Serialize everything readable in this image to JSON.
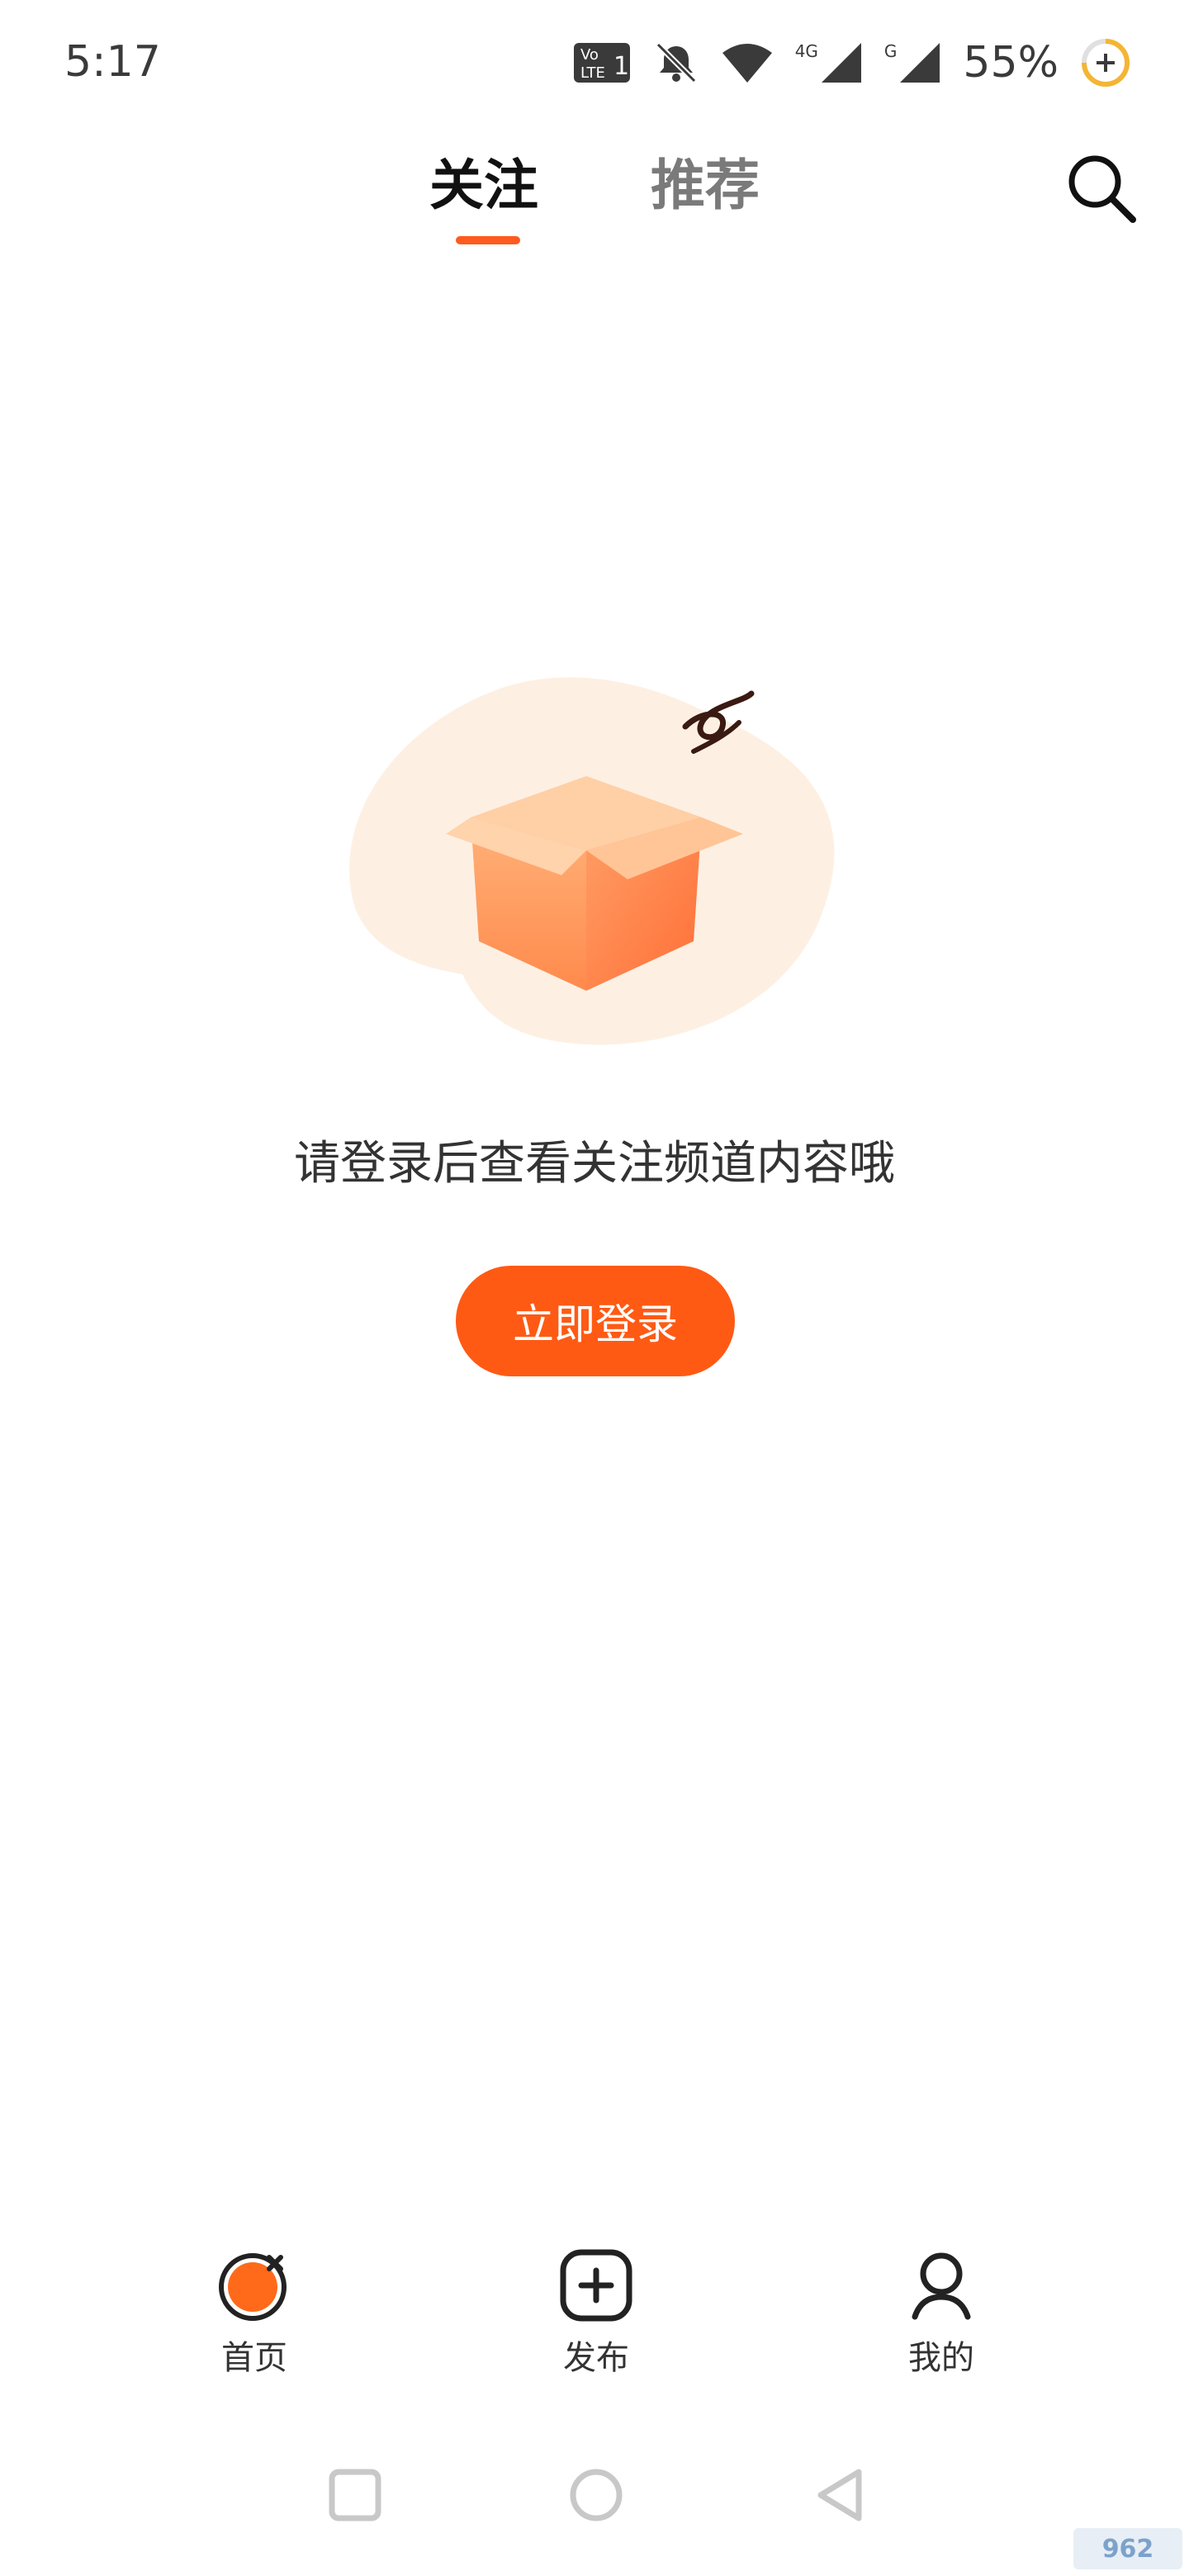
{
  "status_bar": {
    "time": "5:17",
    "network_4g": "4G",
    "network_g": "G",
    "battery": "55%"
  },
  "header": {
    "tabs": [
      {
        "label": "关注",
        "active": true
      },
      {
        "label": "推荐",
        "active": false
      }
    ],
    "search_icon": "search-icon"
  },
  "empty_state": {
    "illustration": "open-box-icon",
    "message": "请登录后查看关注频道内容哦",
    "login_button": "立即登录"
  },
  "bottom_nav": {
    "items": [
      {
        "label": "首页",
        "icon": "home-icon",
        "active": true
      },
      {
        "label": "发布",
        "icon": "plus-square-icon",
        "active": false
      },
      {
        "label": "我的",
        "icon": "user-icon",
        "active": false
      }
    ]
  },
  "watermark": "962",
  "colors": {
    "accent": "#ff5a14",
    "blob": "#fdf0e3",
    "box": "#ff9d62"
  }
}
